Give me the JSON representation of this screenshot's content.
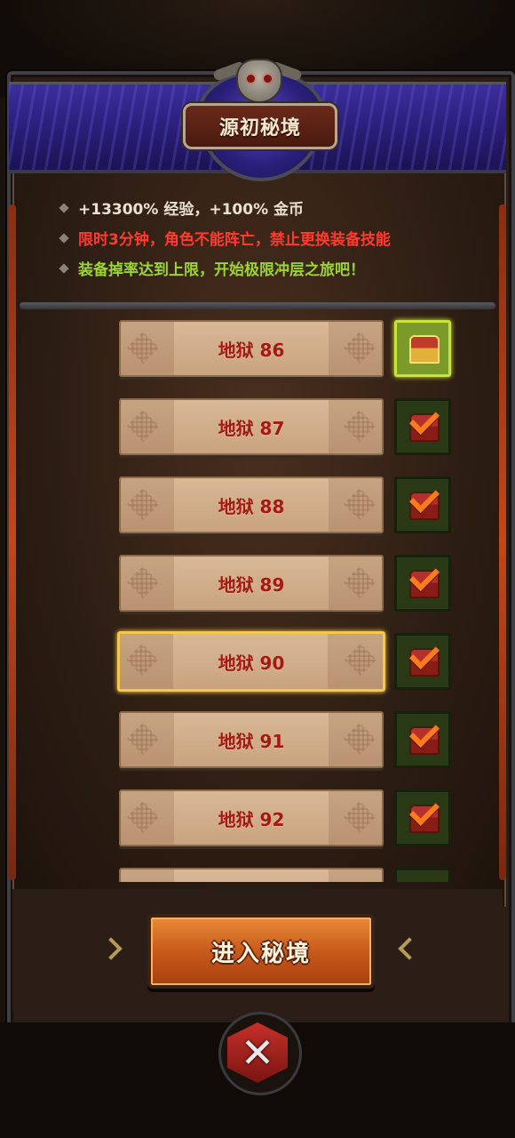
{
  "header": {
    "title": "源初秘境"
  },
  "info": [
    {
      "text": "+13300% 经验，+100% 金币",
      "color": "#e9e1d2"
    },
    {
      "text": "限时3分钟，角色不能阵亡，禁止更换装备技能",
      "color": "#ff3b2e"
    },
    {
      "text": "装备掉率达到上限，开始极限冲层之旅吧！",
      "color": "#9bd633"
    }
  ],
  "floors": [
    {
      "label": "地狱 86",
      "reward": "chest-claimable",
      "selected": false
    },
    {
      "label": "地狱 87",
      "reward": "chest-claimed",
      "selected": false
    },
    {
      "label": "地狱 88",
      "reward": "chest-claimed",
      "selected": false
    },
    {
      "label": "地狱 89",
      "reward": "chest-claimed",
      "selected": false
    },
    {
      "label": "地狱 90",
      "reward": "chest-claimed",
      "selected": true
    },
    {
      "label": "地狱 91",
      "reward": "chest-claimed",
      "selected": false
    },
    {
      "label": "地狱 92",
      "reward": "chest-claimed",
      "selected": false
    },
    {
      "label": "",
      "reward": "chest-claimed",
      "selected": false
    }
  ],
  "actions": {
    "enter_label": "进入秘境"
  },
  "colors": {
    "banner": "#2a1f7a",
    "accent_orange": "#c85a1a",
    "floor_text": "#a31a12",
    "selected_border": "#f4c84c"
  }
}
